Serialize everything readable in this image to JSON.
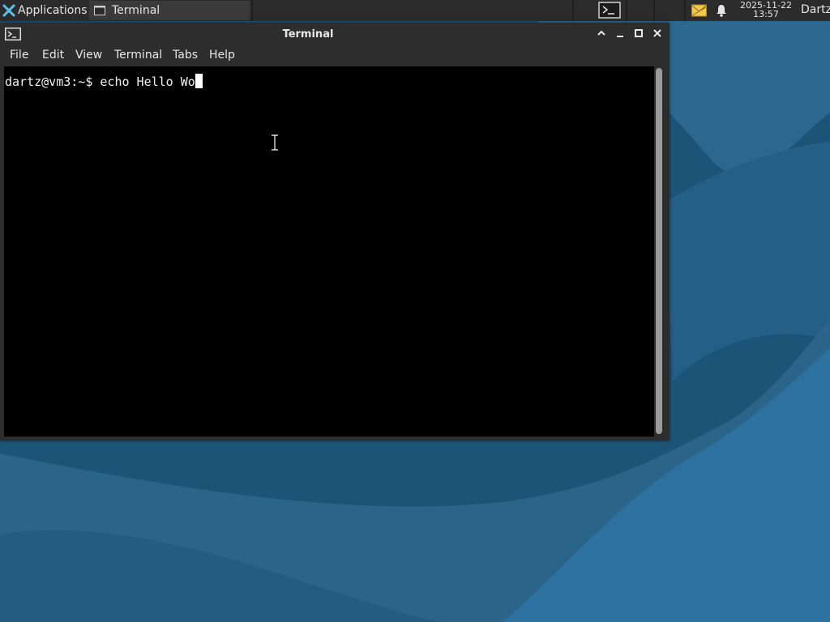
{
  "panel": {
    "applications_label": "Applications",
    "task_title": "Terminal",
    "clock_date": "2025-11-22",
    "clock_time": "13:57",
    "user": "Dartz"
  },
  "window": {
    "title": "Terminal",
    "menu": [
      "File",
      "Edit",
      "View",
      "Terminal",
      "Tabs",
      "Help"
    ],
    "prompt": "dartz@vm3:~$ ",
    "command": "echo Hello Wo"
  },
  "icons": {
    "panel": [
      "xfce-mouse-icon",
      "terminal-task-icon",
      "terminal-tray-icon",
      "mail-icon",
      "bell-icon"
    ],
    "window": [
      "terminal-app-icon",
      "shade-icon",
      "minimize-icon",
      "maximize-icon",
      "close-icon"
    ]
  },
  "colors": {
    "panel_bg": "#2b2b2b",
    "window_bg": "#2d2d2d",
    "terminal_bg": "#000000",
    "desktop": "#1f5a80"
  }
}
